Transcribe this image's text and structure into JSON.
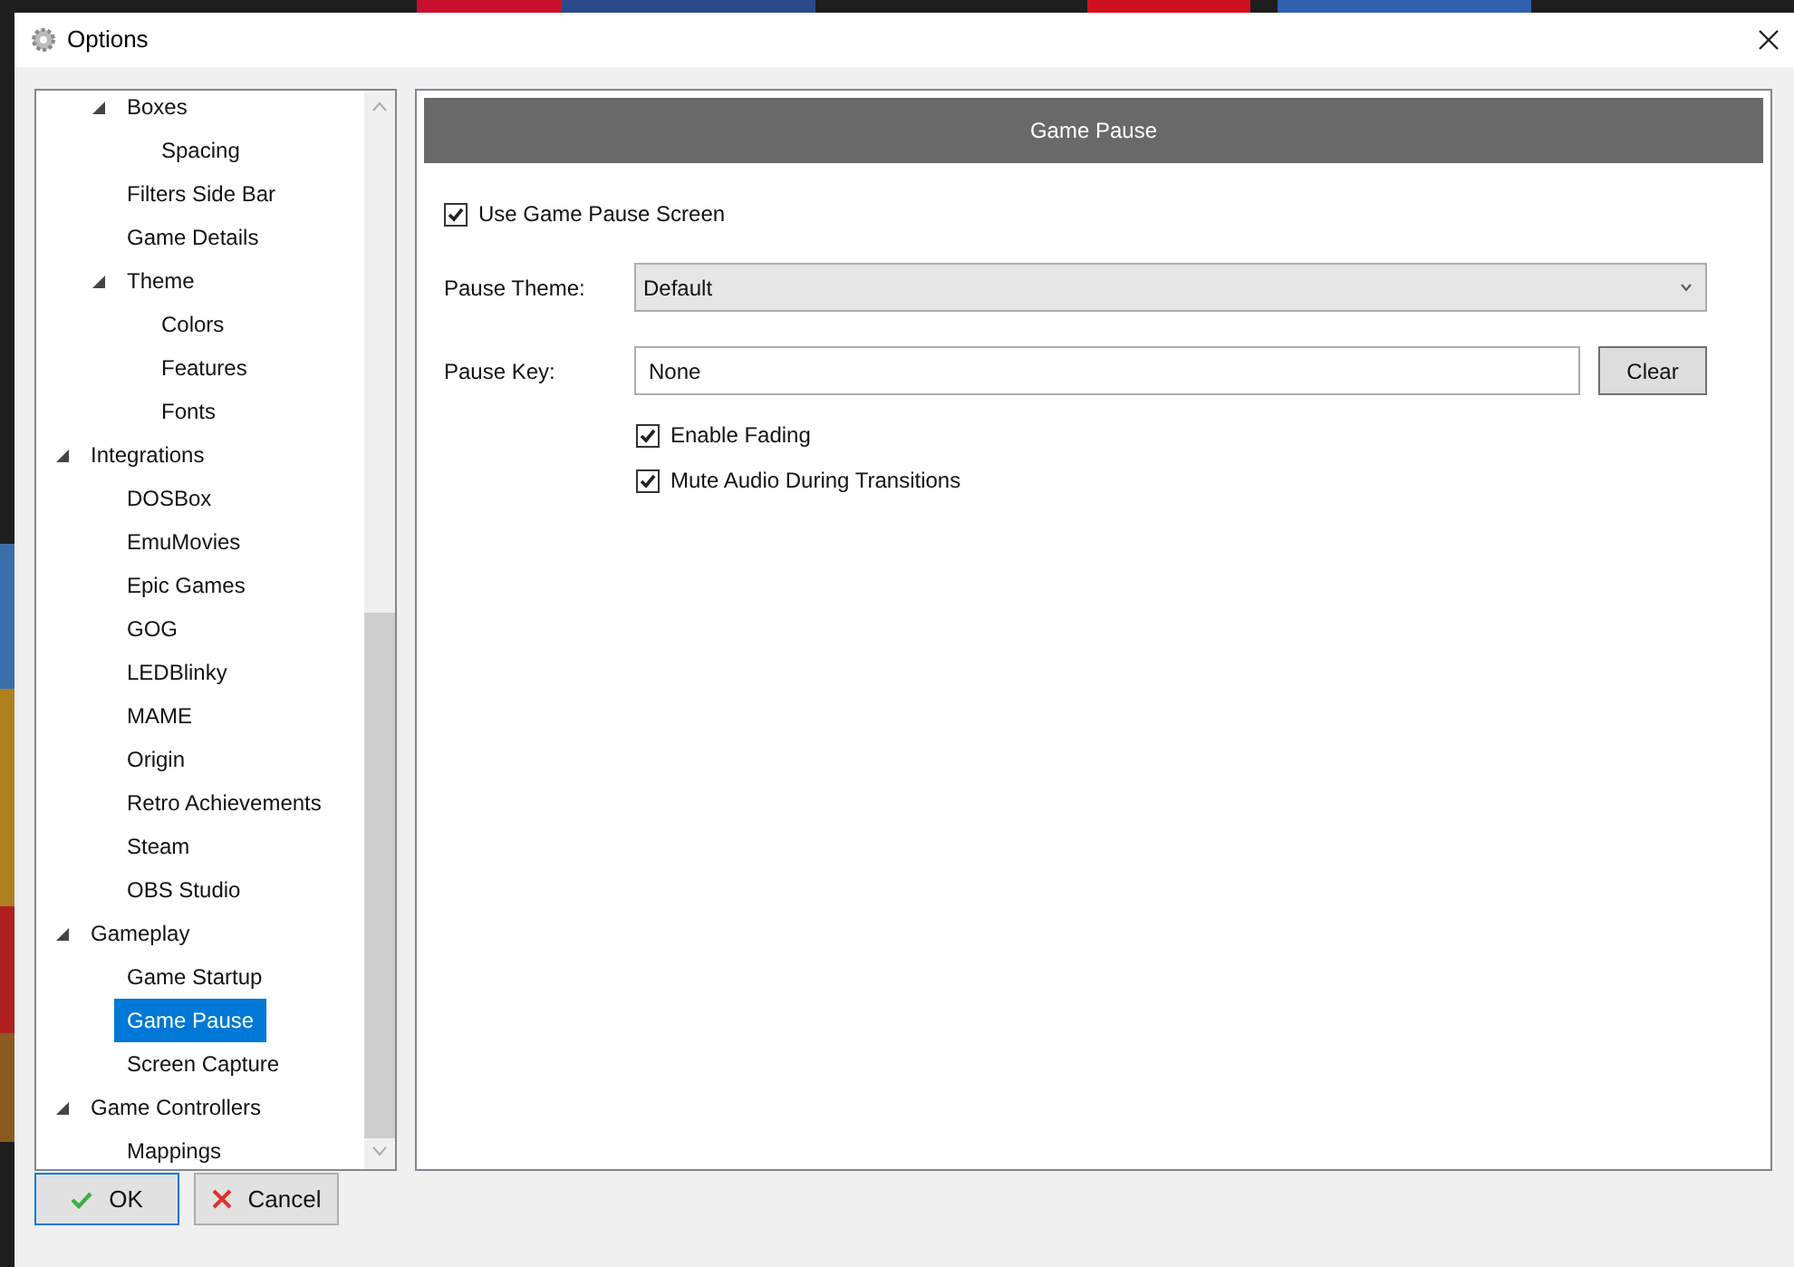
{
  "window": {
    "title": "Options"
  },
  "tree": {
    "items": [
      {
        "children": [
          {
            "label": "Boxes",
            "expanded": true,
            "selected": false,
            "children": [
              {
                "label": "Spacing",
                "selected": false
              }
            ]
          },
          {
            "label": "Filters Side Bar",
            "selected": false
          },
          {
            "label": "Game Details",
            "selected": false
          },
          {
            "label": "Theme",
            "expanded": true,
            "selected": false,
            "children": [
              {
                "label": "Colors",
                "selected": false
              },
              {
                "label": "Features",
                "selected": false
              },
              {
                "label": "Fonts",
                "selected": false
              }
            ]
          }
        ]
      },
      {
        "label": "Integrations",
        "expanded": true,
        "selected": false,
        "children": [
          {
            "label": "DOSBox",
            "selected": false
          },
          {
            "label": "EmuMovies",
            "selected": false
          },
          {
            "label": "Epic Games",
            "selected": false
          },
          {
            "label": "GOG",
            "selected": false
          },
          {
            "label": "LEDBlinky",
            "selected": false
          },
          {
            "label": "MAME",
            "selected": false
          },
          {
            "label": "Origin",
            "selected": false
          },
          {
            "label": "Retro Achievements",
            "selected": false
          },
          {
            "label": "Steam",
            "selected": false
          },
          {
            "label": "OBS Studio",
            "selected": false
          }
        ]
      },
      {
        "label": "Gameplay",
        "expanded": true,
        "selected": false,
        "children": [
          {
            "label": "Game Startup",
            "selected": false
          },
          {
            "label": "Game Pause",
            "selected": true
          },
          {
            "label": "Screen Capture",
            "selected": false
          }
        ]
      },
      {
        "label": "Game Controllers",
        "expanded": true,
        "selected": false,
        "children": [
          {
            "label": "Mappings",
            "selected": false
          }
        ]
      }
    ]
  },
  "panel": {
    "header": "Game Pause",
    "use_screen": {
      "label": "Use Game Pause Screen",
      "checked": true
    },
    "pause_theme": {
      "label": "Pause Theme:",
      "value": "Default"
    },
    "pause_key": {
      "label": "Pause Key:",
      "value": "None",
      "button": "Clear"
    },
    "options": [
      {
        "label": "Enable Fading",
        "checked": true
      },
      {
        "label": "Mute Audio During Transitions",
        "checked": true
      }
    ]
  },
  "buttons": [
    {
      "kind": "ok",
      "label": "OK",
      "focused": true
    },
    {
      "kind": "cancel",
      "label": "Cancel",
      "focused": false
    }
  ]
}
